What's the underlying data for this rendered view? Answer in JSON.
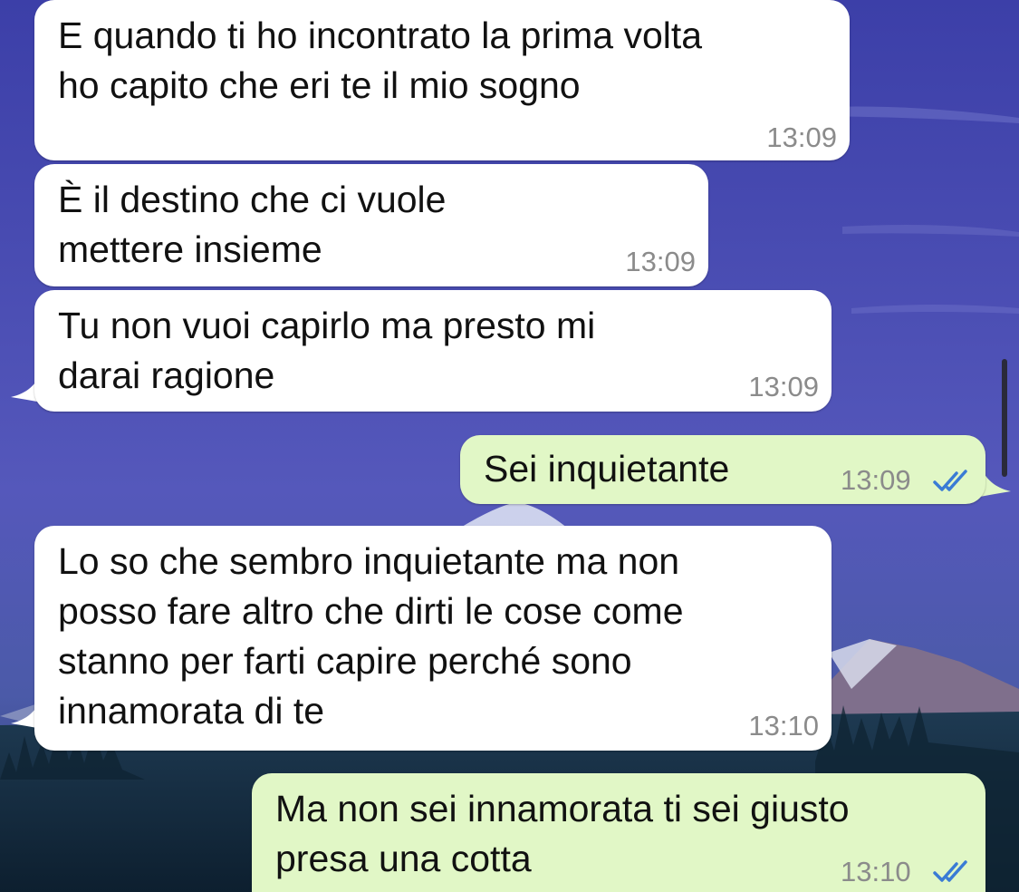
{
  "chat": {
    "messages": [
      {
        "id": "m1",
        "direction": "incoming",
        "lines": [
          "E quando ti ho incontrato la prima volta",
          "ho capito che eri te il mio sogno"
        ],
        "time": "13:09"
      },
      {
        "id": "m2",
        "direction": "incoming",
        "lines": [
          "È il destino che ci vuole",
          "mettere insieme"
        ],
        "time": "13:09"
      },
      {
        "id": "m3",
        "direction": "incoming",
        "lines": [
          "Tu non vuoi capirlo ma presto mi",
          "darai ragione"
        ],
        "time": "13:09"
      },
      {
        "id": "m4",
        "direction": "outgoing",
        "lines": [
          "Sei inquietante"
        ],
        "time": "13:09",
        "status_icon": "double-check-icon"
      },
      {
        "id": "m5",
        "direction": "incoming",
        "lines": [
          "Lo so che sembro inquietante ma non",
          "posso fare altro che dirti le cose come",
          "stanno per farti capire perché sono",
          "innamorata di te"
        ],
        "time": "13:10"
      },
      {
        "id": "m6",
        "direction": "outgoing",
        "lines": [
          "Ma non sei innamorata ti sei giusto",
          "presa una cotta"
        ],
        "time": "13:10",
        "status_icon": "double-check-icon"
      }
    ]
  },
  "colors": {
    "incoming_bubble": "#ffffff",
    "outgoing_bubble": "#e1f7c6",
    "timestamp": "#8b8b8b",
    "read_ticks": "#3a7bd5",
    "wallpaper_sky": "#4a4fb0"
  }
}
